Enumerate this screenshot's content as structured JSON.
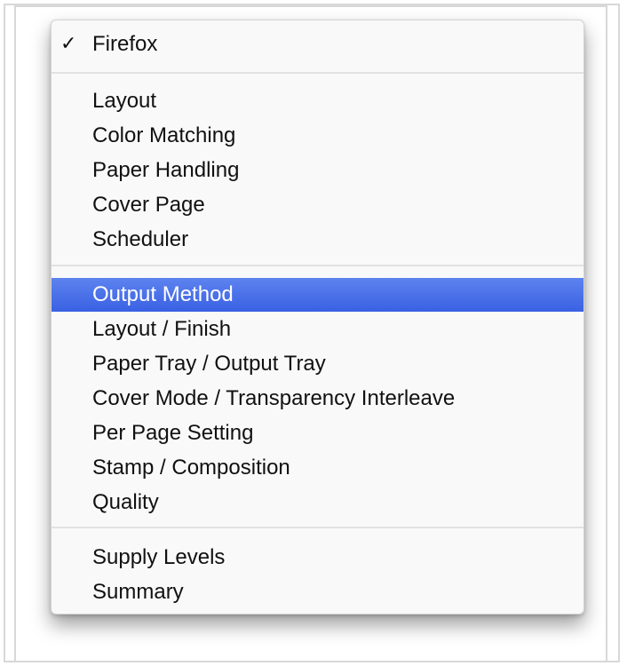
{
  "menu": {
    "current": {
      "check": "✓",
      "label": "Firefox"
    },
    "groups": [
      {
        "items": [
          "Layout",
          "Color Matching",
          "Paper Handling",
          "Cover Page",
          "Scheduler"
        ]
      },
      {
        "items": [
          "Output Method",
          "Layout / Finish",
          "Paper Tray / Output Tray",
          "Cover Mode / Transparency Interleave",
          "Per Page Setting",
          "Stamp / Composition",
          "Quality"
        ]
      },
      {
        "items": [
          "Supply Levels",
          "Summary"
        ]
      }
    ],
    "selected": "Output Method",
    "highlight_color": "#3d63e4"
  }
}
